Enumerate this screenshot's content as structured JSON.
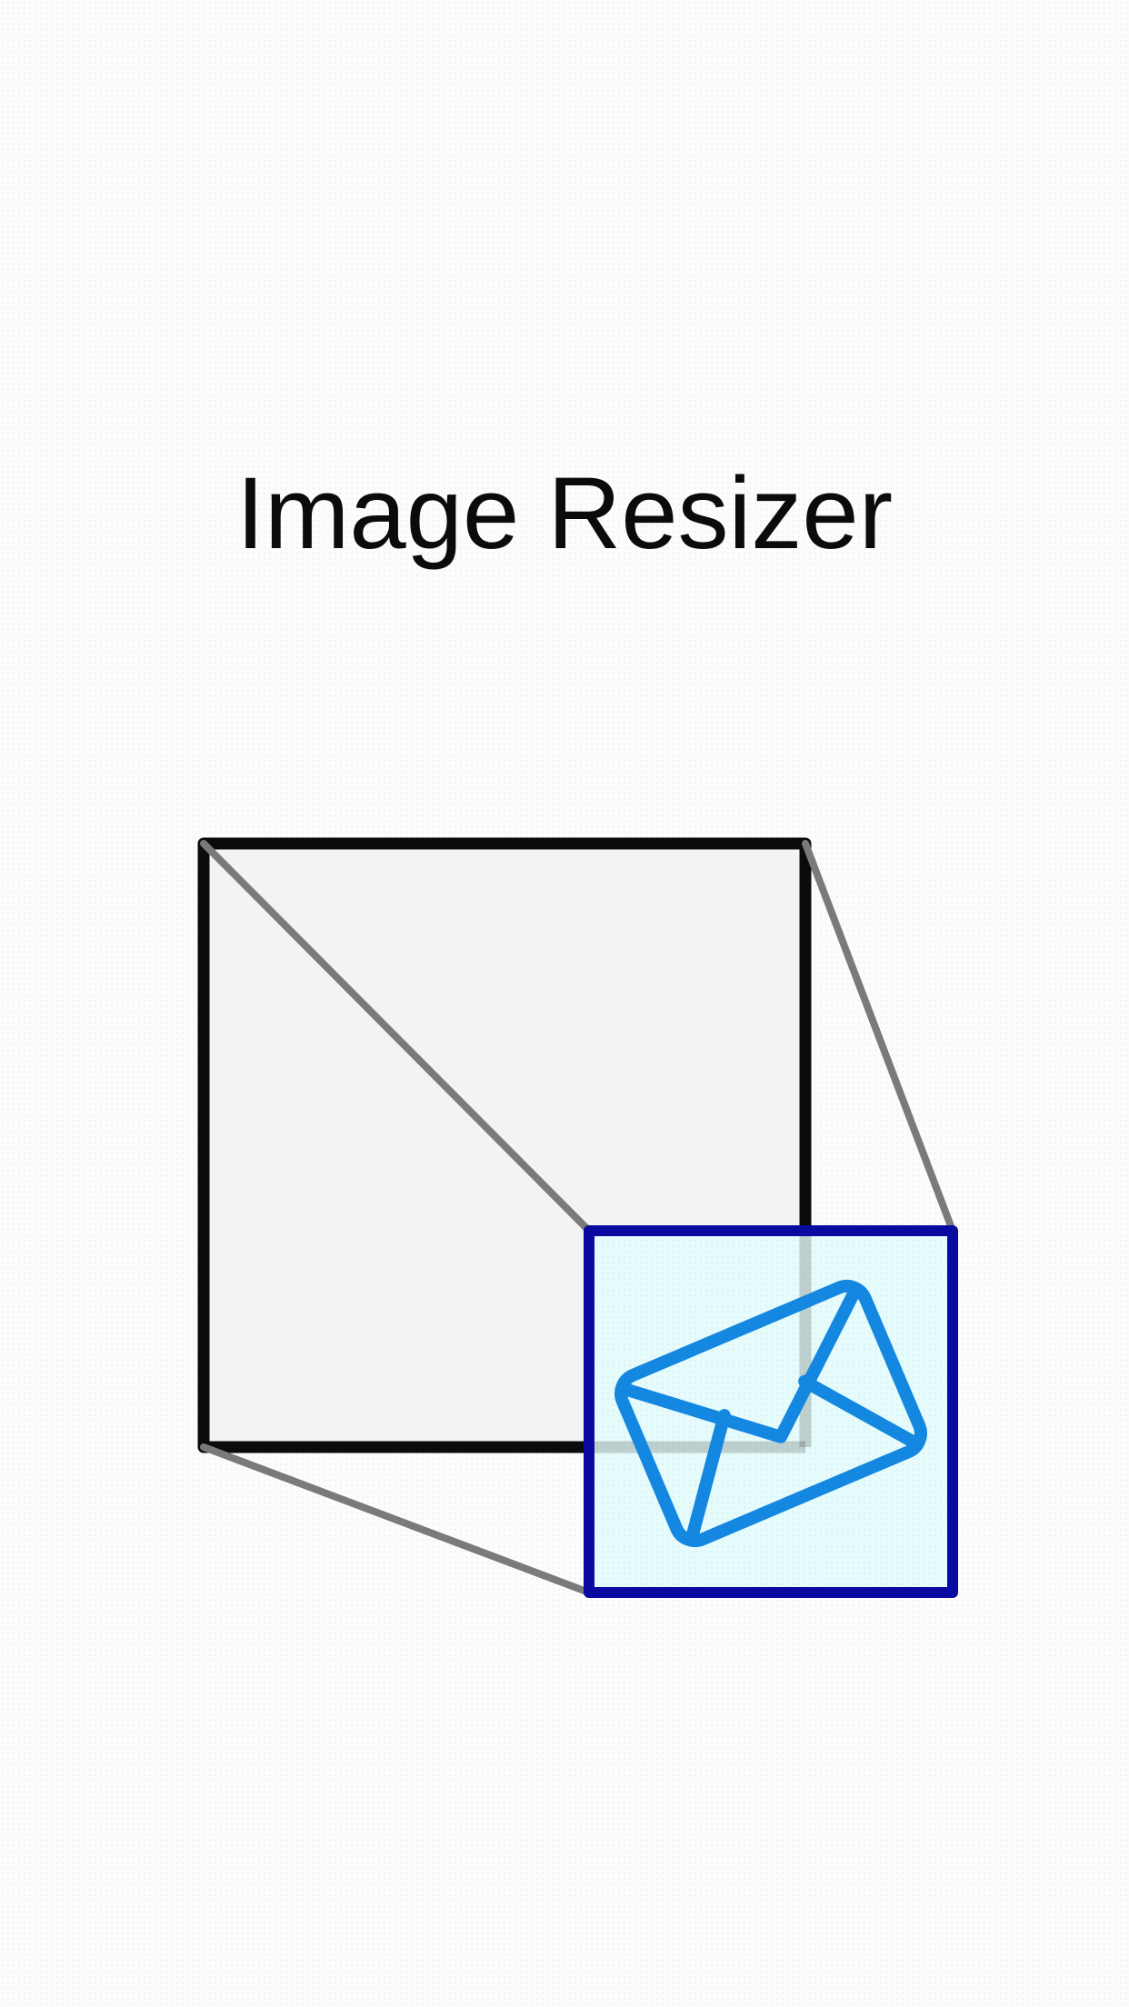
{
  "app": {
    "title": "Image Resizer"
  },
  "illustration": {
    "large_frame_icon": "large-image-frame",
    "small_frame_icon": "resized-image-frame",
    "content_icon": "envelope-icon"
  },
  "colors": {
    "background": "#fcfcfc",
    "large_frame_stroke": "#0b0b0b",
    "large_frame_fill": "#f3f3f3",
    "connector_lines": "#7a7a7a",
    "small_frame_stroke": "#0a0aa0",
    "small_frame_fill": "#e6fbfb",
    "envelope": "#1487e0"
  }
}
